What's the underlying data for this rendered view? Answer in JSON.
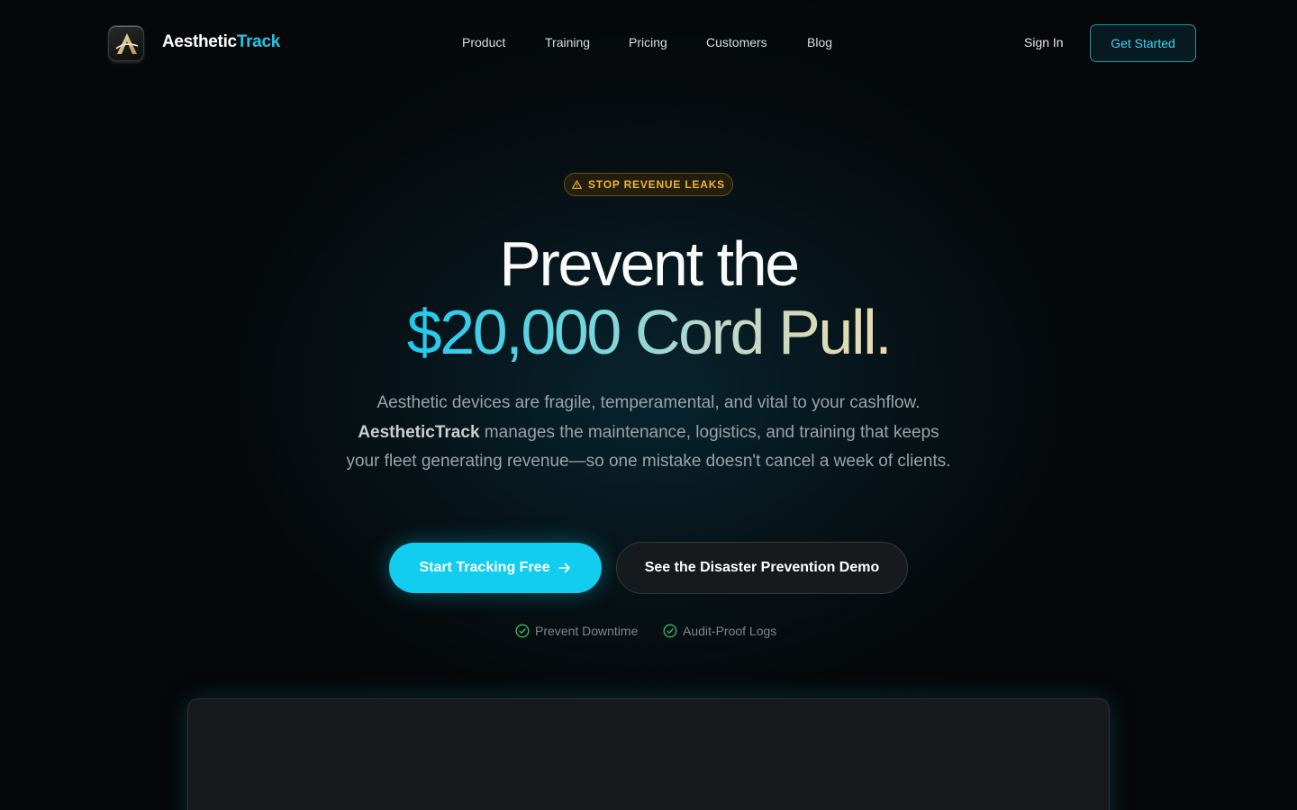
{
  "header": {
    "brand_part1": "Aesthetic",
    "brand_part2": "Track",
    "nav": [
      "Product",
      "Training",
      "Pricing",
      "Customers",
      "Blog"
    ],
    "sign_in": "Sign In",
    "get_started": "Get Started"
  },
  "hero": {
    "badge": "STOP REVENUE LEAKS",
    "headline_line1": "Prevent the",
    "headline_line2": "$20,000 Cord Pull.",
    "sub_lead": "Aesthetic devices are fragile, temperamental, and vital to your cashflow.",
    "sub_brand": "AestheticTrack",
    "sub_rest": "manages the maintenance, logistics, and training that keeps your fleet generating revenue—so one mistake doesn't cancel a week of clients.",
    "cta_primary": "Start Tracking Free",
    "cta_secondary": "See the Disaster Prevention Demo",
    "trust": [
      "Prevent Downtime",
      "Audit-Proof Logs"
    ]
  },
  "colors": {
    "accent": "#12cdef",
    "badge": "#f0b53a",
    "background": "#050708"
  },
  "icons": {
    "logo": "stylized-a-logo-icon",
    "badge": "warning-triangle-icon",
    "cta": "arrow-right-icon",
    "trust": "check-circle-icon"
  }
}
